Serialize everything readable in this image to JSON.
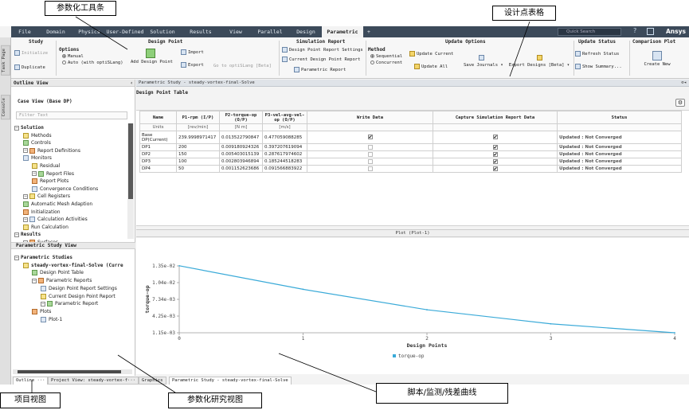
{
  "menubar": {
    "items": [
      "File",
      "Domain",
      "Physics",
      "User-Defined",
      "Solution",
      "Results",
      "View",
      "Parallel",
      "Design",
      "Parametric",
      "+"
    ],
    "active": "Parametric",
    "search_placeholder": "Quick Search",
    "brand": "Ansys"
  },
  "vtabs": [
    "Task Page",
    "Console"
  ],
  "ribbon": {
    "study": {
      "title": "Study",
      "initialize": "Initialize",
      "duplicate": "Duplicate"
    },
    "options": {
      "title": "Options",
      "manual": "Manual",
      "auto": "Auto (with optiSLang)"
    },
    "design_point": {
      "title": "Design Point",
      "add": "Add Design Point",
      "import": "Import",
      "export": "Export",
      "optislang": "Go to optiSLang [Beta]"
    },
    "sim_report": {
      "title": "Simulation Report",
      "settings": "Design Point Report Settings",
      "current": "Current Design Point Report",
      "parametric": "Parametric Report"
    },
    "method": {
      "title": "Method",
      "sequential": "Sequential",
      "concurrent": "Concurrent"
    },
    "update_options": {
      "title": "Update Options",
      "update_current": "Update Current",
      "update_all": "Update All",
      "save_journals": "Save Journals",
      "export_designs": "Export Designs [Beta]"
    },
    "update_status": {
      "title": "Update Status",
      "refresh": "Refresh Status",
      "summary": "Show Summary..."
    },
    "comparison": {
      "title": "Comparison Plot",
      "create": "Create New"
    }
  },
  "outline": {
    "title": "Outline View",
    "case": "Case View (Base DP)",
    "filter_placeholder": "Filter Text",
    "items": [
      {
        "label": "Solution",
        "level": 0,
        "bold": true
      },
      {
        "label": "Methods",
        "level": 1
      },
      {
        "label": "Controls",
        "level": 1
      },
      {
        "label": "Report Definitions",
        "level": 1
      },
      {
        "label": "Monitors",
        "level": 1
      },
      {
        "label": "Residual",
        "level": 2
      },
      {
        "label": "Report Files",
        "level": 2
      },
      {
        "label": "Report Plots",
        "level": 2
      },
      {
        "label": "Convergence Conditions",
        "level": 2
      },
      {
        "label": "Cell Registers",
        "level": 1
      },
      {
        "label": "Automatic Mesh Adaption",
        "level": 1
      },
      {
        "label": "Initialization",
        "level": 1
      },
      {
        "label": "Calculation Activities",
        "level": 1
      },
      {
        "label": "Run Calculation",
        "level": 1
      },
      {
        "label": "Results",
        "level": 0,
        "bold": true
      },
      {
        "label": "Surfaces",
        "level": 1
      }
    ]
  },
  "parametric_view": {
    "title": "Parametric Study View",
    "items": [
      {
        "label": "Parametric Studies",
        "level": 0,
        "bold": true
      },
      {
        "label": "steady-vortex-final-Solve (Curre",
        "level": 1,
        "bold": true
      },
      {
        "label": "Design Point Table",
        "level": 2
      },
      {
        "label": "Parametric Reports",
        "level": 2
      },
      {
        "label": "Design Point Report Settings",
        "level": 3
      },
      {
        "label": "Current Design Point Report",
        "level": 3
      },
      {
        "label": "Parametric Report",
        "level": 3
      },
      {
        "label": "Plots",
        "level": 2
      },
      {
        "label": "Plot-1",
        "level": 3
      }
    ]
  },
  "bottom_tabs": [
    "Outline ···",
    "Project View: steady-vortex-f···",
    "Graphics",
    "Parametric Study - steady-vortex-final-Solve"
  ],
  "main": {
    "title": "Parametric Study - steady-vortex-final-Solve",
    "table_title": "Design Point Table",
    "plot_title": "Plot (Plot-1)"
  },
  "table": {
    "headers": [
      "Name",
      "P1-rpm (I/P)",
      "P2-torque-op (O/P)",
      "P3-vel-avg-vel-op (O/P)",
      "Write Data",
      "Capture Simulation Report Data",
      "Status"
    ],
    "units": [
      "Units",
      "[rev/min]",
      "[N m]",
      "[m/s]",
      "",
      "",
      ""
    ],
    "rows": [
      {
        "name": "Base DP(Current)",
        "rpm": "239.9998971417",
        "torque": "0.013522790847",
        "vel": "0.477059088285",
        "write": true,
        "capture": true,
        "status": "Updated : Not Converged"
      },
      {
        "name": "DP1",
        "rpm": "200",
        "torque": "0.009180924326",
        "vel": "0.397207619094",
        "write": false,
        "capture": true,
        "status": "Updated : Not Converged"
      },
      {
        "name": "DP2",
        "rpm": "150",
        "torque": "0.005403015139",
        "vel": "0.287617974602",
        "write": false,
        "capture": true,
        "status": "Updated : Not Converged"
      },
      {
        "name": "DP3",
        "rpm": "100",
        "torque": "0.002803946894",
        "vel": "0.185244518283",
        "write": false,
        "capture": true,
        "status": "Updated : Not Converged"
      },
      {
        "name": "DP4",
        "rpm": "50",
        "torque": "0.001152623686",
        "vel": "0.091566883922",
        "write": false,
        "capture": true,
        "status": "Updated : Not Converged"
      }
    ]
  },
  "chart_data": {
    "type": "line",
    "title": "Plot (Plot-1)",
    "xlabel": "Design Points",
    "ylabel": "torque-op",
    "x": [
      0,
      1,
      2,
      3,
      4
    ],
    "xticks": [
      "0",
      "1",
      "2",
      "3",
      "4"
    ],
    "yticks": [
      "1.35e-02",
      "1.04e-02",
      "7.34e-03",
      "4.25e-03",
      "1.15e-03"
    ],
    "ylim": [
      0.00115,
      0.0135
    ],
    "xlim": [
      0,
      4
    ],
    "series": [
      {
        "name": "torque-op",
        "color": "#3aaad8",
        "values": [
          0.013522790847,
          0.009180924326,
          0.005403015139,
          0.002803946894,
          0.001152623686
        ]
      }
    ],
    "grid": false,
    "legend": "bottom-center"
  },
  "annotations": {
    "toolbar": "参数化工具条",
    "table": "设计点表格",
    "project": "项目视图",
    "study": "参数化研究视图",
    "curves": "脚本/监测/残差曲线"
  }
}
